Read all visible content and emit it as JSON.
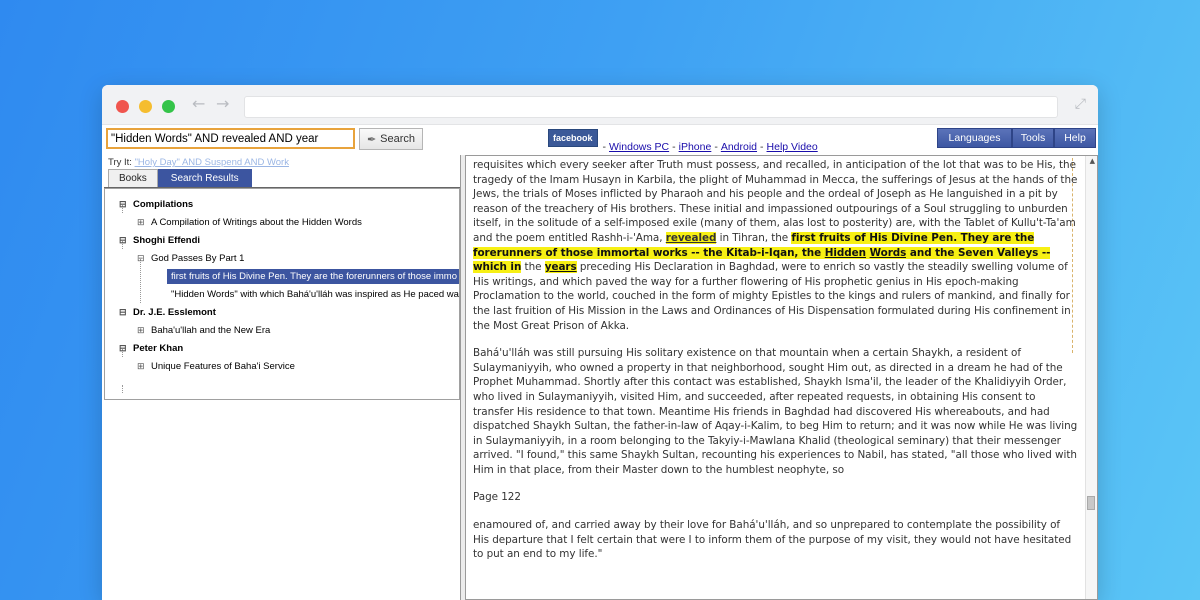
{
  "search": {
    "query": "\"Hidden Words\" AND revealed AND year",
    "button_label": "Search"
  },
  "links": {
    "facebook": "facebook",
    "sep": "-",
    "windows": "Windows PC",
    "iphone": "iPhone",
    "android": "Android",
    "help_video": "Help Video"
  },
  "menu": {
    "languages": "Languages",
    "tools": "Tools",
    "help": "Help"
  },
  "tryit": {
    "label": "Try It:",
    "example": "\"Holy Day\" AND Suspend AND Work"
  },
  "tabs": {
    "books": "Books",
    "results": "Search Results"
  },
  "tree": {
    "compilations": "Compilations",
    "compilation_item": "A Compilation of Writings about the Hidden Words",
    "shoghi": "Shoghi Effendi",
    "god_passes": "God Passes By Part 1",
    "result1": "first fruits of His Divine Pen. They are the forerunners of those immo",
    "result2": "\"Hidden Words\" with which Bahá'u'lláh was inspired as He paced wa",
    "esslemont": "Dr. J.E. Esslemont",
    "new_era": "Baha'u'llah and the New Era",
    "khan": "Peter Khan",
    "unique": "Unique Features of Baha'i Service"
  },
  "reader": {
    "p1a": "requisites which every seeker after Truth must possess, and recalled, in anticipation of the lot that was to be His, the tragedy of the Imam Husayn in Karbila, the plight of Muhammad in Mecca, the sufferings of Jesus at the hands of the Jews, the trials of Moses inflicted by Pharaoh and his people and the ordeal of Joseph as He languished in a pit by reason of the treachery of His brothers. These initial and impassioned outpourings of a Soul struggling to unburden itself, in the solitude of a self-imposed exile (many of them, alas lost to posterity) are, with the Tablet of Kullu't-Ta'am and the poem entitled Rashh-i-'Ama, ",
    "revealed": "revealed",
    "p1b": " in Tihran, the ",
    "hl1": "first fruits of His Divine Pen. They are the forerunners of those immortal works -- the Kitab-i-Iqan, the ",
    "hidden": "Hidden",
    "space": " ",
    "words": "Words",
    "hl2": " and the Seven Valleys -- which in",
    "p1c": " the ",
    "years": "years",
    "p1d": " preceding His Declaration in Baghdad, were to enrich so vastly the steadily swelling volume of His writings, and which paved the way for a further flowering of His prophetic genius in His epoch-making Proclamation to the world, couched in the form of mighty Epistles to the kings and rulers of mankind, and finally for the last fruition of His Mission in the Laws and Ordinances of His Dispensation formulated during His confinement in the Most Great Prison of Akka.",
    "p2": "Bahá'u'lláh was still pursuing His solitary existence on that mountain when a certain Shaykh, a resident of Sulaymaniyyih, who owned a property in that neighborhood, sought Him out, as directed in a dream he had of the Prophet Muhammad. Shortly after this contact was established, Shaykh Isma'il, the leader of the Khalidiyyih Order, who lived in Sulaymaniyyih, visited Him, and succeeded, after repeated requests, in obtaining His consent to transfer His residence to that town. Meantime His friends in Baghdad had discovered His whereabouts, and had dispatched Shaykh Sultan, the father-in-law of Aqay-i-Kalim, to beg Him to return; and it was now while He was living in Sulaymaniyyih, in a room belonging to the Takyiy-i-Mawlana Khalid (theological seminary) that their messenger arrived. \"I found,\" this same Shaykh Sultan, recounting his experiences to Nabil, has stated, \"all those who lived with Him in that place, from their Master down to the humblest neophyte, so",
    "page": "Page 122",
    "p3": "enamoured of, and carried away by their love for Bahá'u'lláh, and so unprepared to contemplate the possibility of His departure that I felt certain that were I to inform them of the purpose of my visit, they would not have hesitated to put an end to my life.\""
  }
}
